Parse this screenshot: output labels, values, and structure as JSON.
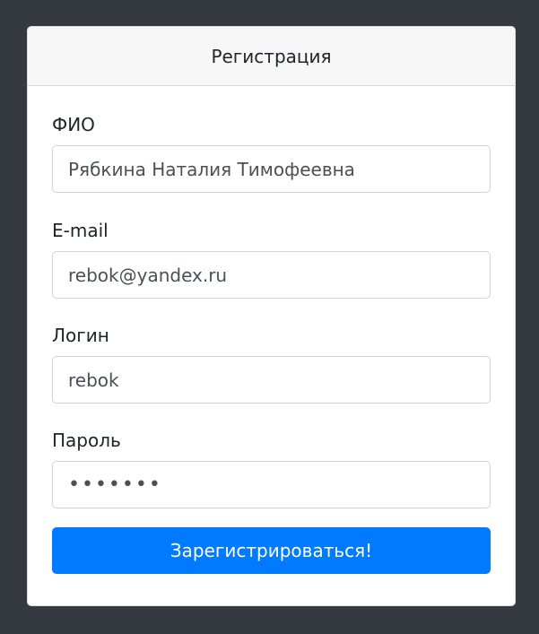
{
  "card": {
    "title": "Регистрация"
  },
  "form": {
    "fio": {
      "label": "ФИО",
      "value": "Рябкина Наталия Тимофеевна"
    },
    "email": {
      "label": "E-mail",
      "value": "rebok@yandex.ru"
    },
    "login": {
      "label": "Логин",
      "value": "rebok"
    },
    "password": {
      "label": "Пароль",
      "value": "•••••••"
    },
    "submit_label": "Зарегистрироваться!"
  },
  "colors": {
    "background": "#343a40",
    "primary": "#007bff"
  }
}
